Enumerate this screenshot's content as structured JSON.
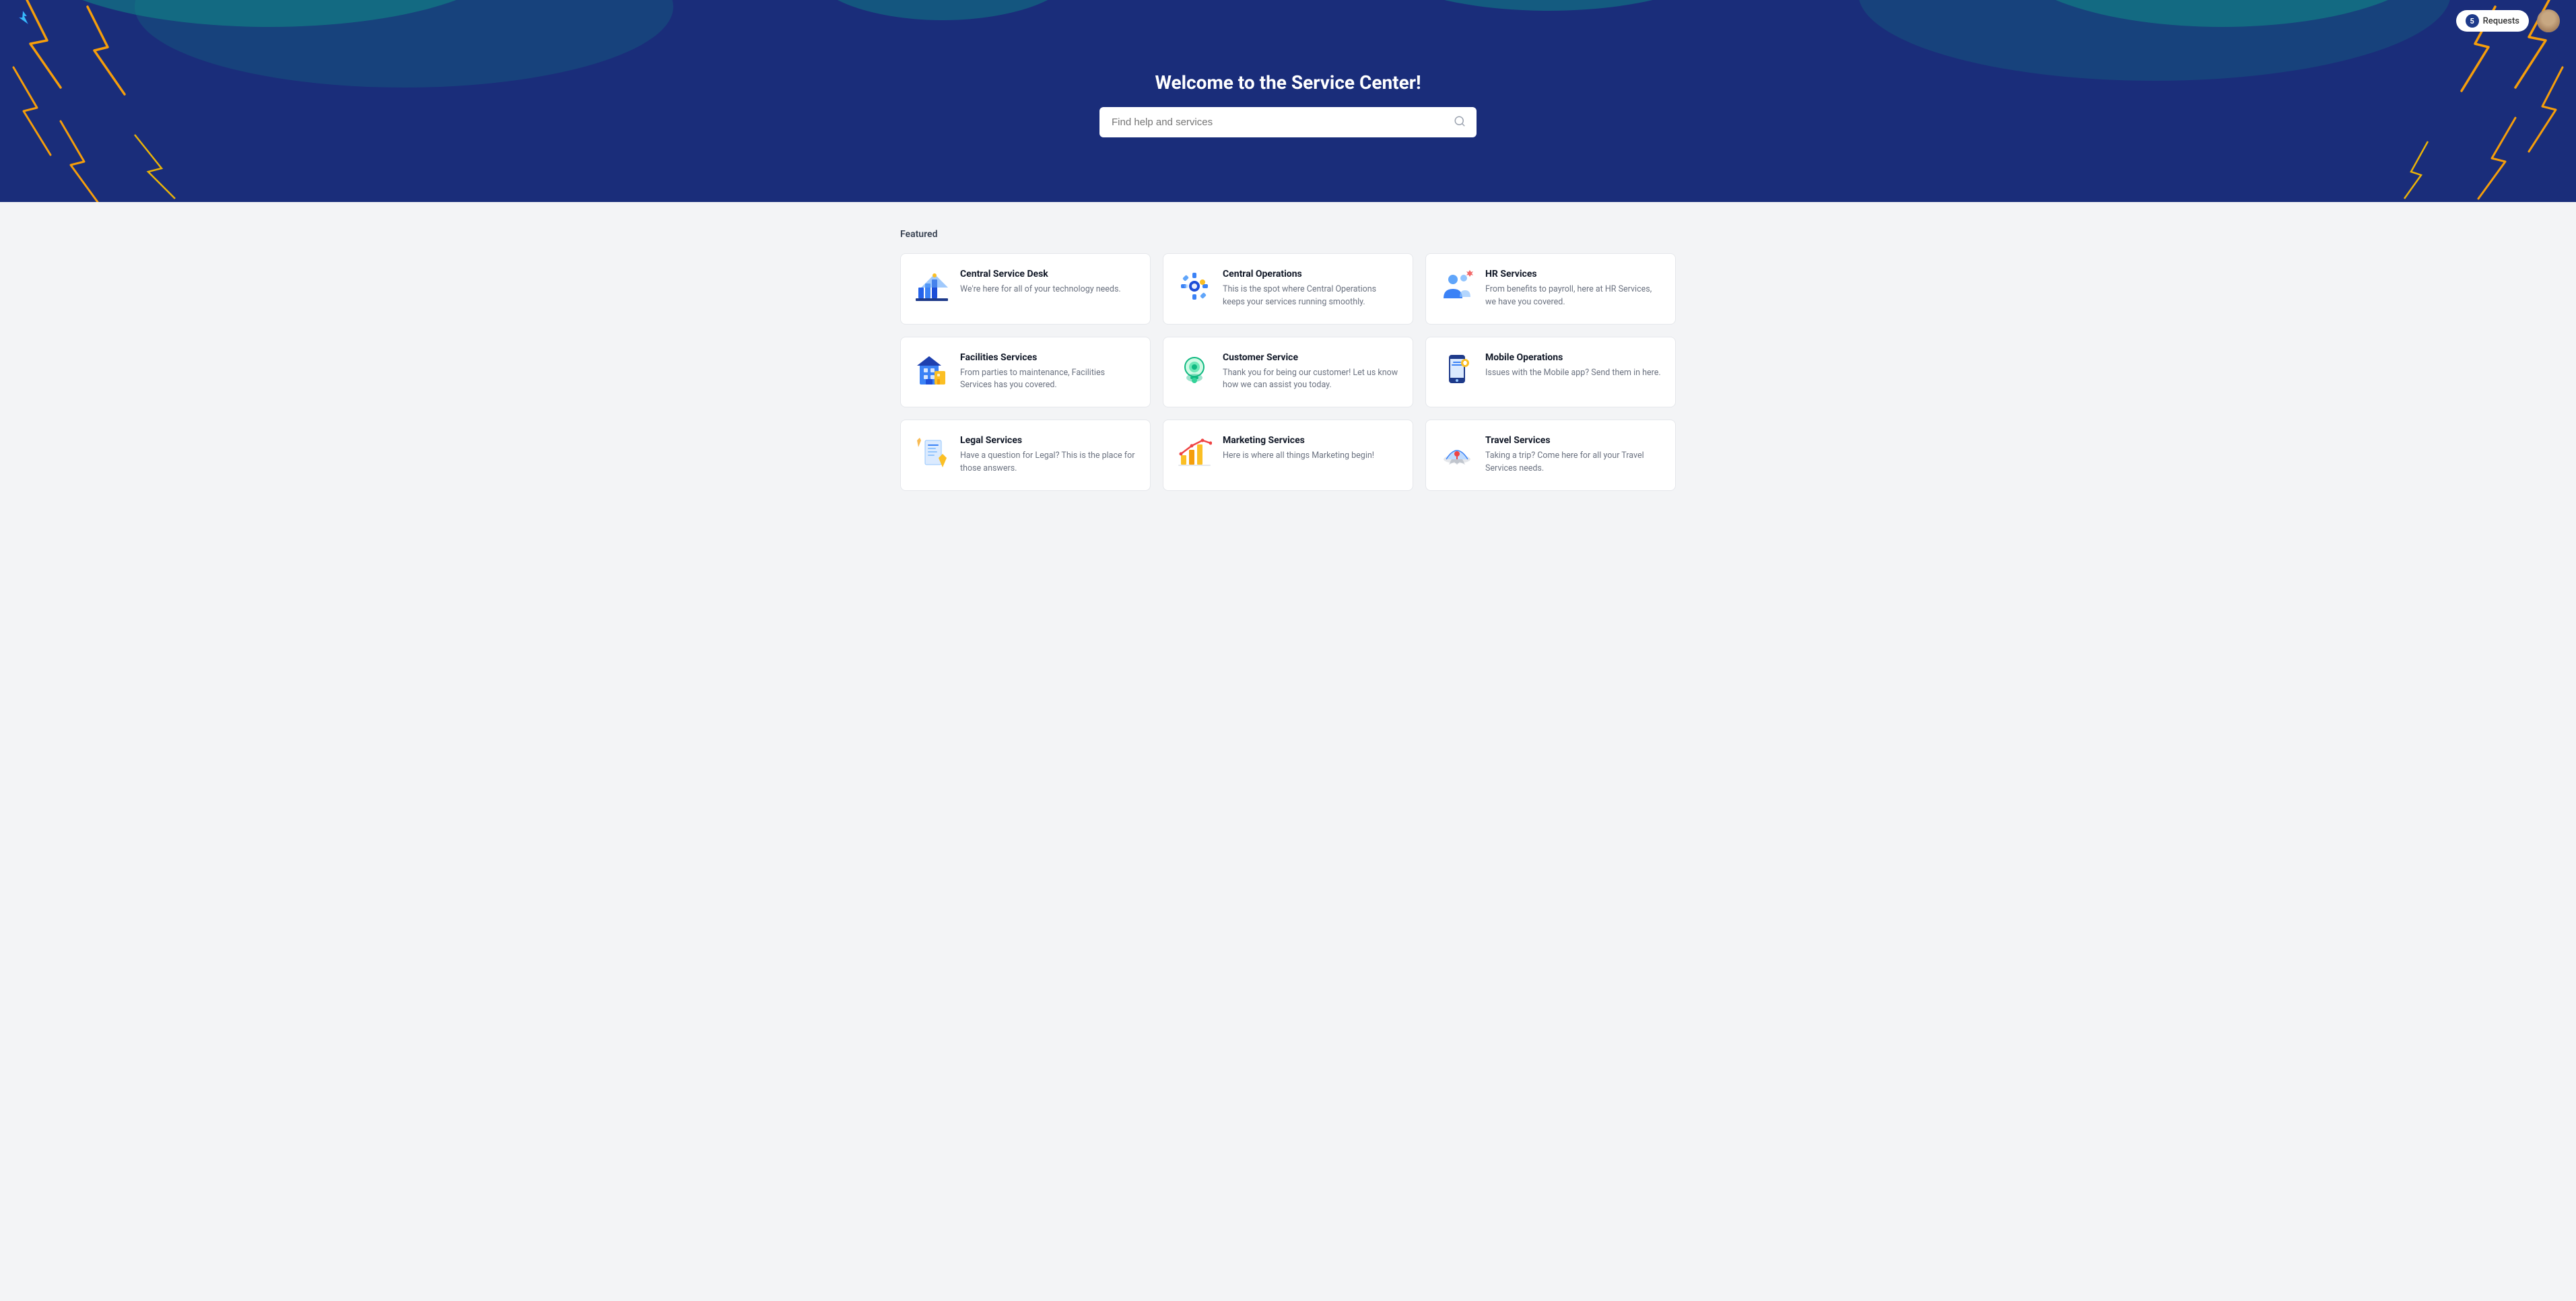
{
  "nav": {
    "requests_count": "5",
    "requests_label": "Requests"
  },
  "hero": {
    "title": "Welcome to the Service Center!",
    "search_placeholder": "Find help and services"
  },
  "featured_section": {
    "label": "Featured"
  },
  "cards": [
    {
      "id": "central-service-desk",
      "title": "Central Service Desk",
      "description": "We're here for all of your technology needs.",
      "icon_color": "#2563eb",
      "icon_type": "tower"
    },
    {
      "id": "central-operations",
      "title": "Central Operations",
      "description": "This is the spot where Central Operations keeps your services running smoothly.",
      "icon_color": "#1d4ed8",
      "icon_type": "gear"
    },
    {
      "id": "hr-services",
      "title": "HR Services",
      "description": "From benefits to payroll, here at HR Services, we have you covered.",
      "icon_color": "#3b82f6",
      "icon_type": "people"
    },
    {
      "id": "facilities-services",
      "title": "Facilities Services",
      "description": "From parties to maintenance, Facilities Services has you covered.",
      "icon_color": "#f59e0b",
      "icon_type": "building"
    },
    {
      "id": "customer-service",
      "title": "Customer Service",
      "description": "Thank you for being our customer! Let us know how we can assist you today.",
      "icon_color": "#10b981",
      "icon_type": "headset"
    },
    {
      "id": "mobile-operations",
      "title": "Mobile Operations",
      "description": "Issues with the Mobile app? Send them in here.",
      "icon_color": "#1e3a8a",
      "icon_type": "mobile"
    },
    {
      "id": "legal-services",
      "title": "Legal Services",
      "description": "Have a question for Legal? This is the place for those answers.",
      "icon_color": "#f59e0b",
      "icon_type": "legal"
    },
    {
      "id": "marketing-services",
      "title": "Marketing Services",
      "description": "Here is where all things Marketing begin!",
      "icon_color": "#f59e0b",
      "icon_type": "chart"
    },
    {
      "id": "travel-services",
      "title": "Travel Services",
      "description": "Taking a trip? Come here for all your Travel Services needs.",
      "icon_color": "#ef4444",
      "icon_type": "travel"
    }
  ]
}
